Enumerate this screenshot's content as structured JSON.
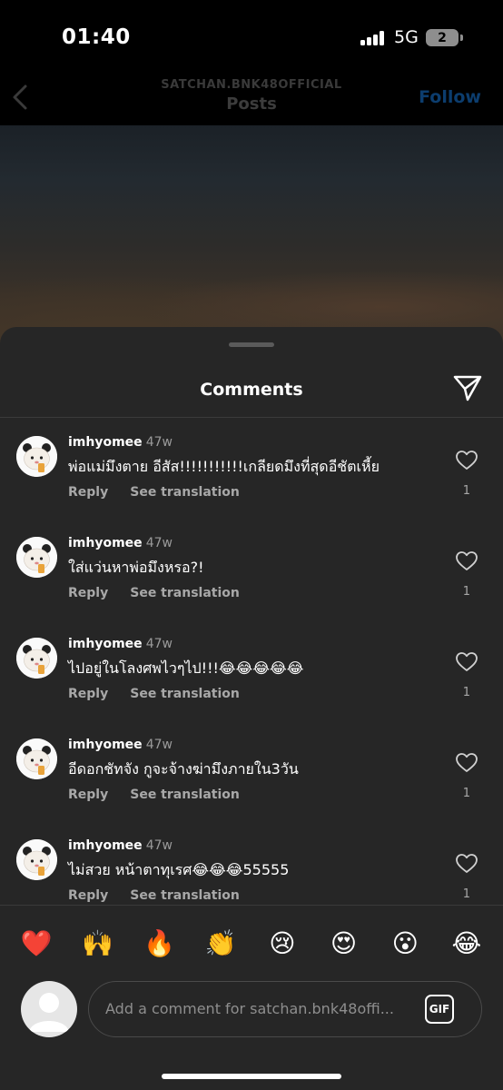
{
  "status": {
    "time": "01:40",
    "network": "5G",
    "battery": "2"
  },
  "nav": {
    "subtitle": "SATCHAN.BNK48OFFICIAL",
    "title": "Posts",
    "follow": "Follow"
  },
  "sheet": {
    "title": "Comments"
  },
  "comments": [
    {
      "username": "imhyomee",
      "age": "47w",
      "text": "พ่อแม่มึงตาย อีสัส!!!!!!!!!!!เกลียดมึงที่สุดอีชัตเหี้ย",
      "reply": "Reply",
      "translate": "See translation",
      "likes": "1"
    },
    {
      "username": "imhyomee",
      "age": "47w",
      "text": "ใส่แว่นหาพ่อมึงหรอ?!",
      "reply": "Reply",
      "translate": "See translation",
      "likes": "1"
    },
    {
      "username": "imhyomee",
      "age": "47w",
      "text": "ไปอยู่ในโลงศพไวๆไป!!!😂😂😂😂😂",
      "reply": "Reply",
      "translate": "See translation",
      "likes": "1"
    },
    {
      "username": "imhyomee",
      "age": "47w",
      "text": "อีดอกชัทจัง กูจะจ้างฆ่ามึงภายใน3วัน",
      "reply": "Reply",
      "translate": "See translation",
      "likes": "1"
    },
    {
      "username": "imhyomee",
      "age": "47w",
      "text": "ไม่สวย หน้าตาทุเรศ😂😂😂55555",
      "reply": "Reply",
      "translate": "See translation",
      "likes": "1"
    }
  ],
  "reactions": [
    "❤️",
    "🙌",
    "🔥",
    "👏",
    "😢",
    "😍",
    "😮",
    "😂"
  ],
  "input": {
    "placeholder": "Add a comment for satchan.bnk48offi...",
    "gif": "GIF"
  },
  "colors": {
    "sheet_bg": "#262626",
    "follow": "#0c3d6e",
    "heart": "#e0245e"
  }
}
